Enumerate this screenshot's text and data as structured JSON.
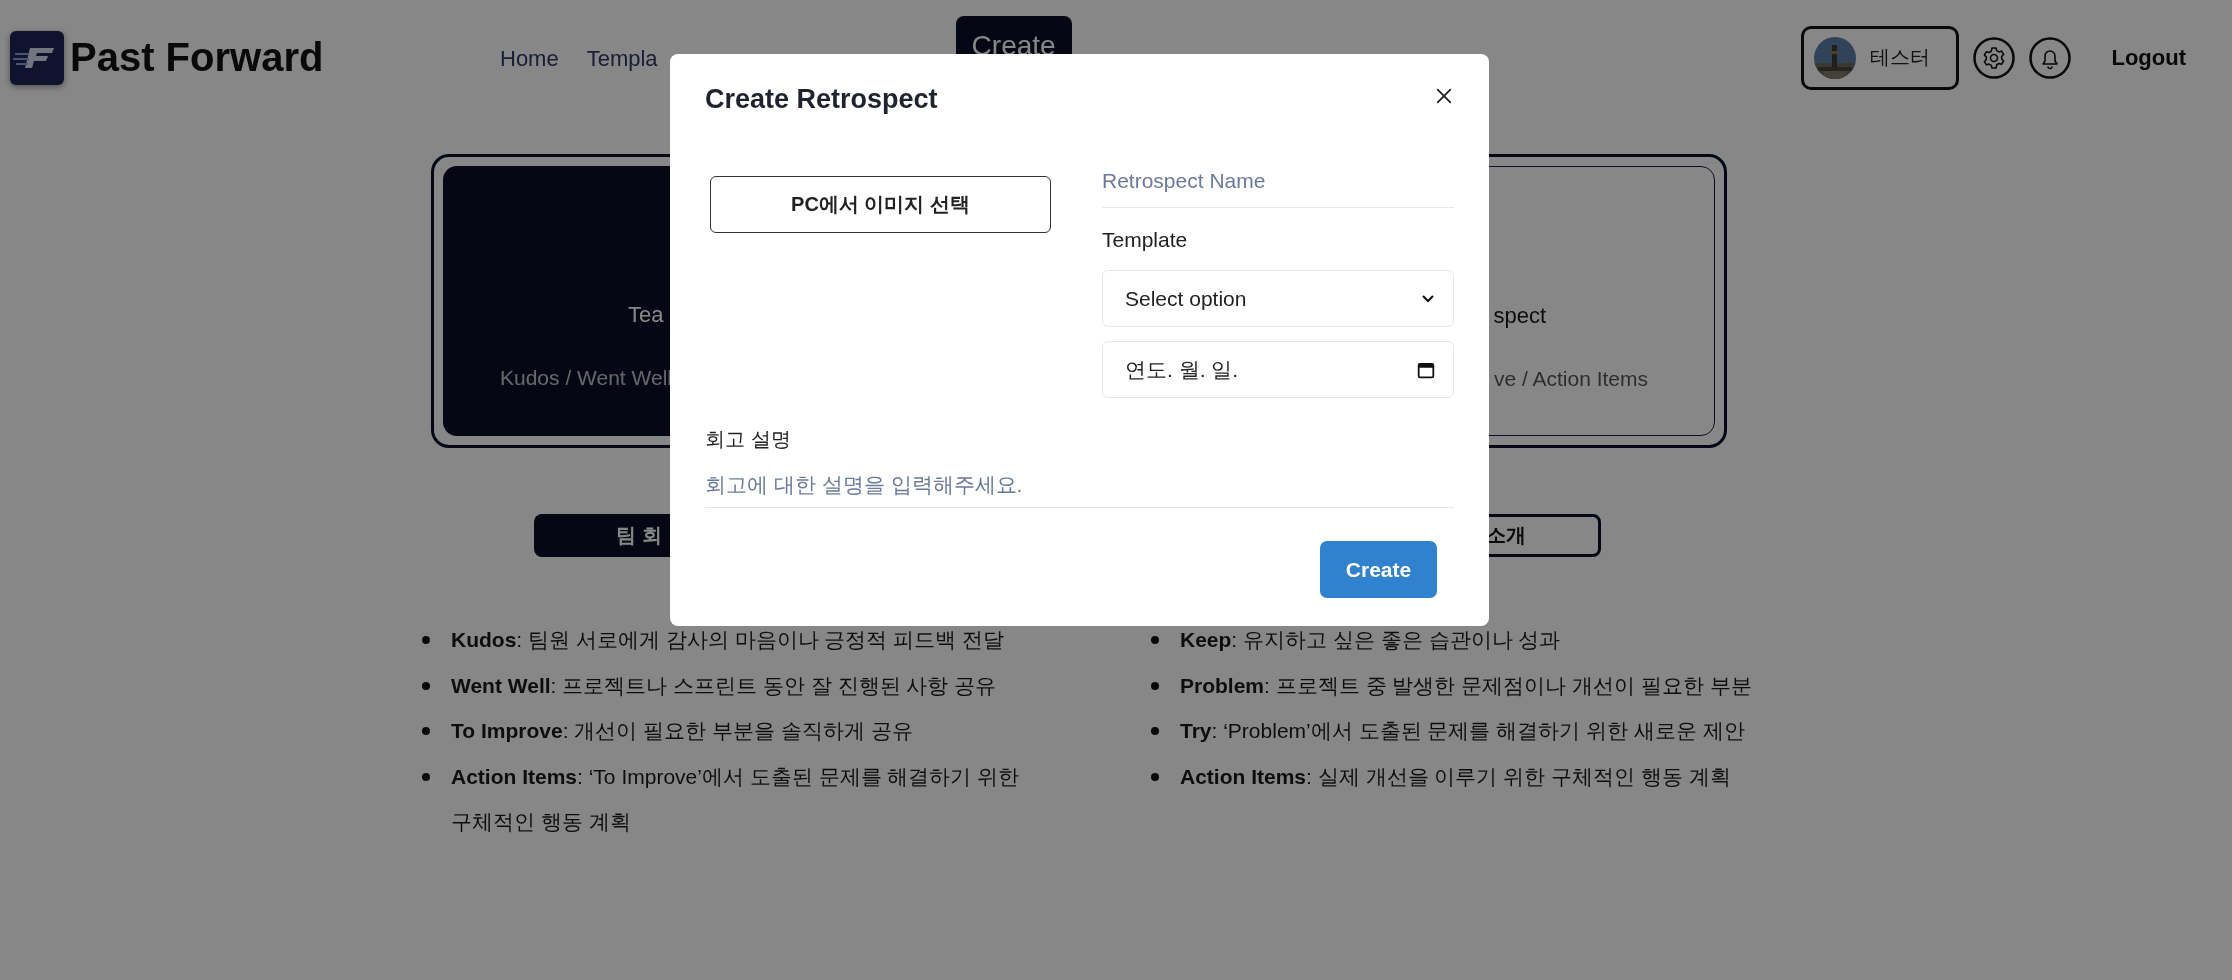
{
  "header": {
    "logo_text": "Past Forward",
    "nav": [
      {
        "label": "Home",
        "kind": "link"
      },
      {
        "label": "Templa",
        "kind": "link"
      },
      {
        "label": "Create",
        "kind": "button"
      }
    ],
    "user": {
      "name": "테스터"
    },
    "logout": "Logout"
  },
  "cards": [
    {
      "title": "Tea",
      "subtitle": "Kudos / Went Well",
      "selected": true
    },
    {
      "title": "spect",
      "subtitle": "ve / Action Items",
      "selected": false
    }
  ],
  "intro_buttons": [
    {
      "label": "팀 회",
      "selected": true
    },
    {
      "label": "소개",
      "selected": false
    }
  ],
  "lists": [
    [
      "**Kudos**: 팀원 서로에게 감사의 마음이나 긍정적 피드백 전달",
      "**Went Well**: 프로젝트나 스프린트 동안 잘 진행된 사항 공유",
      "**To Improve**: 개선이 필요한 부분을 솔직하게 공유",
      "**Action Items**: ‘To Improve’에서 도출된 문제를 해결하기 위한 구체적인 행동 계획"
    ],
    [
      "**Keep**: 유지하고 싶은 좋은 습관이나 성과",
      "**Problem**: 프로젝트 중 발생한 문제점이나 개선이 필요한 부분",
      "**Try**: ‘Problem’에서 도출된 문제를 해결하기 위한 새로운 제안",
      "**Action Items**: 실제 개선을 이루기 위한 구체적인 행동 계획"
    ]
  ],
  "modal": {
    "title": "Create Retrospect",
    "image_button": "PC에서 이미지 선택",
    "name_placeholder": "Retrospect Name",
    "template_label": "Template",
    "template_value": "Select option",
    "date_value": "연도. 월. 일.",
    "description_label": "회고 설명",
    "description_placeholder": "회고에 대한 설명을 입력해주세요.",
    "submit": "Create"
  }
}
